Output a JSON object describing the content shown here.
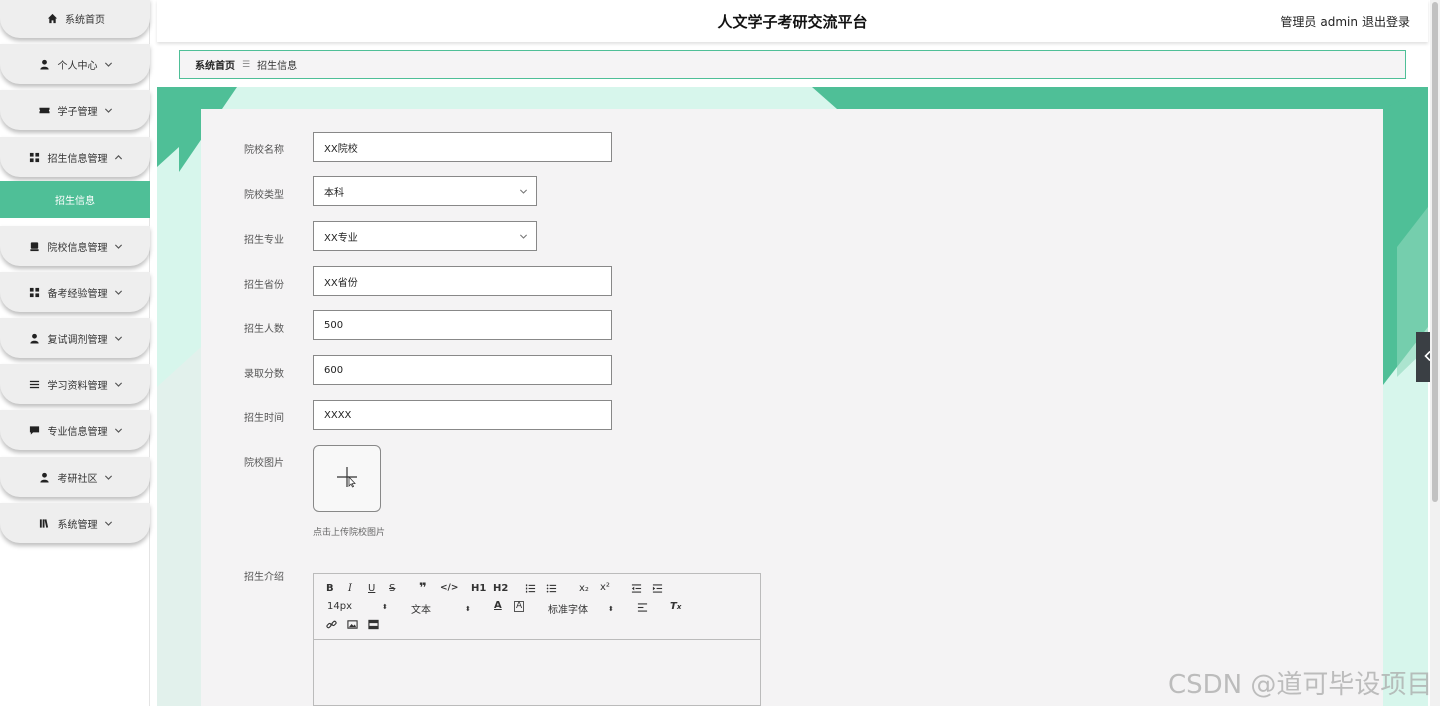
{
  "header": {
    "title": "人文学子考研交流平台",
    "user_role": "管理员",
    "username": "admin",
    "logout": "退出登录"
  },
  "sidebar": {
    "items": [
      {
        "label": "系统首页",
        "icon": "home-icon"
      },
      {
        "label": "个人中心",
        "icon": "user-icon"
      },
      {
        "label": "学子管理",
        "icon": "ticket-icon"
      },
      {
        "label": "招生信息管理",
        "icon": "grid-icon"
      },
      {
        "label": "院校信息管理",
        "icon": "school-icon"
      },
      {
        "label": "备考经验管理",
        "icon": "grid-icon"
      },
      {
        "label": "复试调剂管理",
        "icon": "user-icon"
      },
      {
        "label": "学习资料管理",
        "icon": "list-icon"
      },
      {
        "label": "专业信息管理",
        "icon": "chat-icon"
      },
      {
        "label": "考研社区",
        "icon": "user-icon"
      },
      {
        "label": "系统管理",
        "icon": "book-icon"
      }
    ],
    "active_sub": "招生信息"
  },
  "breadcrumb": {
    "home": "系统首页",
    "separator": "☰",
    "current": "招生信息"
  },
  "form": {
    "school_name": {
      "label": "院校名称",
      "value": "XX院校"
    },
    "school_type": {
      "label": "院校类型",
      "value": "本科"
    },
    "major": {
      "label": "招生专业",
      "value": "XX专业"
    },
    "province": {
      "label": "招生省份",
      "value": "XX省份"
    },
    "count": {
      "label": "招生人数",
      "value": "500"
    },
    "score": {
      "label": "录取分数",
      "value": "600"
    },
    "time": {
      "label": "招生时间",
      "value": "XXXX"
    },
    "image": {
      "label": "院校图片",
      "hint": "点击上传院校图片"
    },
    "intro": {
      "label": "招生介绍"
    }
  },
  "editor": {
    "h1": "H1",
    "h2": "H2",
    "sub": "x₂",
    "sup": "x²",
    "font_size": "14px",
    "text_type": "文本",
    "font_family": "标准字体"
  },
  "watermark": "CSDN @道可毕设项目",
  "colors": {
    "accent": "#4fbf97",
    "card": "#f4f3f4"
  }
}
